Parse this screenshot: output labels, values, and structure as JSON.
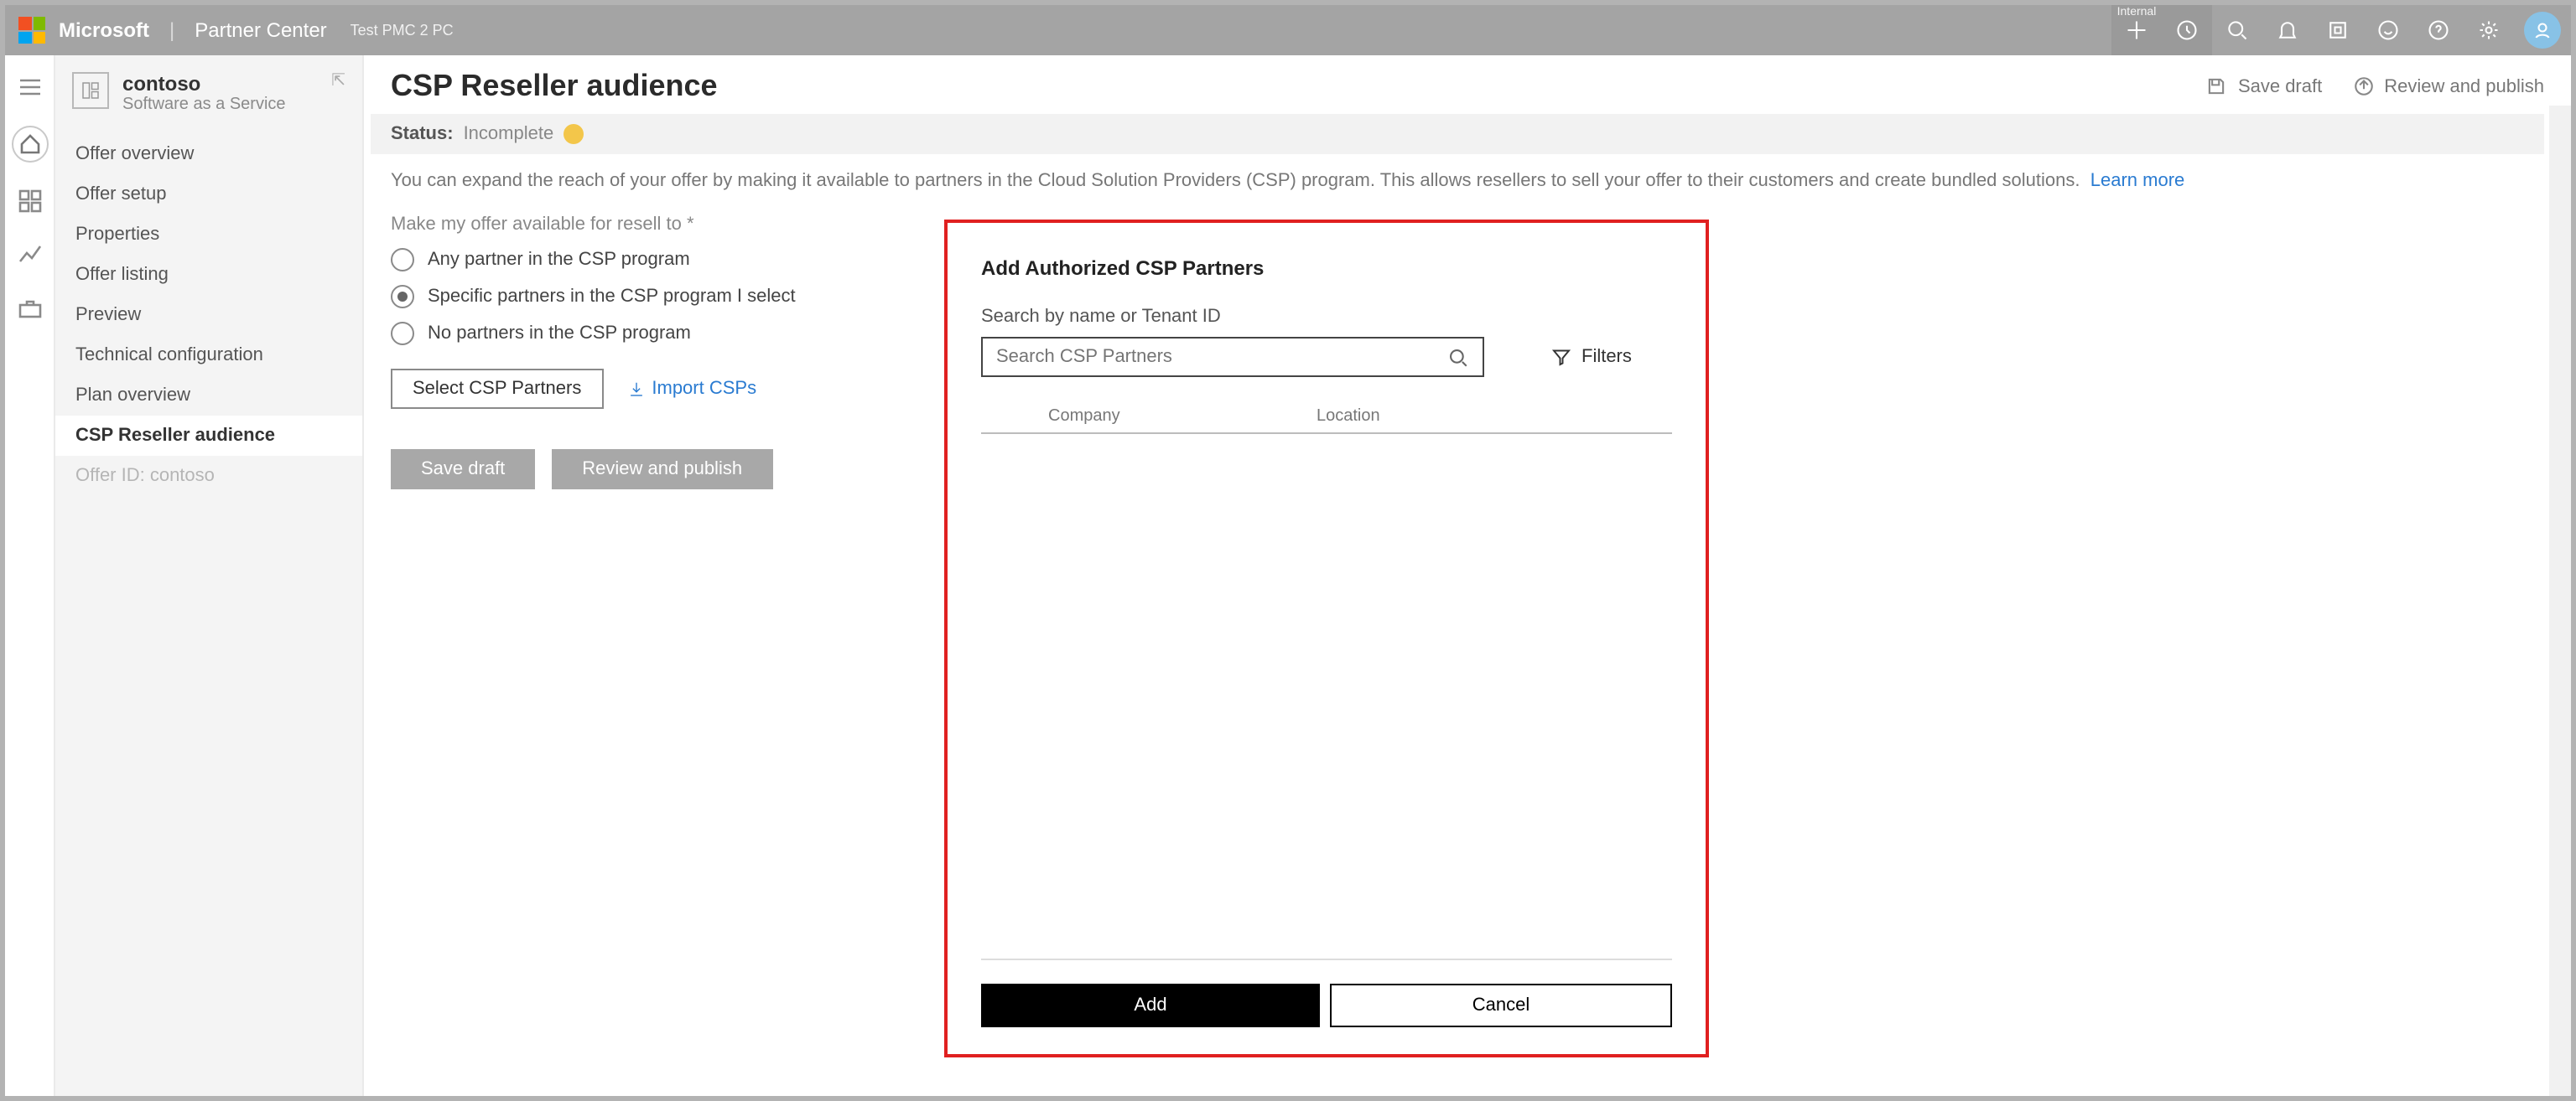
{
  "topbar": {
    "brand": "Microsoft",
    "product": "Partner Center",
    "tag": "Test PMC 2 PC",
    "internal_label": "Internal"
  },
  "sidebar": {
    "tenant_name": "contoso",
    "tenant_type": "Software as a Service",
    "items": [
      {
        "label": "Offer overview"
      },
      {
        "label": "Offer setup"
      },
      {
        "label": "Properties"
      },
      {
        "label": "Offer listing"
      },
      {
        "label": "Preview"
      },
      {
        "label": "Technical configuration"
      },
      {
        "label": "Plan overview"
      },
      {
        "label": "CSP Reseller audience"
      },
      {
        "label": "Offer ID: contoso"
      }
    ],
    "active_index": 7
  },
  "header": {
    "title": "CSP Reseller audience",
    "save_draft": "Save draft",
    "review_publish": "Review and publish"
  },
  "status": {
    "label": "Status:",
    "value": "Incomplete"
  },
  "blurb": {
    "text": "You can expand the reach of your offer by making it available to partners in the Cloud Solution Providers (CSP) program. This allows resellers to sell your offer to their customers and create bundled solutions.",
    "learn_more": "Learn more"
  },
  "reseller": {
    "section_label": "Make my offer available for resell to",
    "options": [
      "Any partner in the CSP program",
      "Specific partners in the CSP program I select",
      "No partners in the CSP program"
    ],
    "selected_index": 1,
    "select_btn": "Select CSP Partners",
    "import_link": "Import CSPs"
  },
  "footer": {
    "save_draft": "Save draft",
    "review_publish": "Review and publish"
  },
  "modal": {
    "title": "Add Authorized CSP Partners",
    "search_label": "Search by name or Tenant ID",
    "search_placeholder": "Search CSP Partners",
    "filters": "Filters",
    "columns": {
      "company": "Company",
      "location": "Location"
    },
    "add": "Add",
    "cancel": "Cancel"
  }
}
